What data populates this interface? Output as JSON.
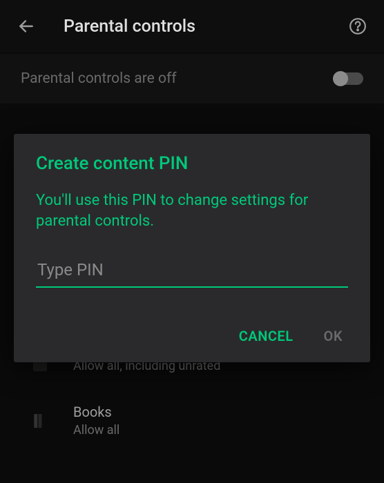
{
  "topbar": {
    "title": "Parental controls"
  },
  "status": {
    "label": "Parental controls are off"
  },
  "dialog": {
    "title": "Create content PIN",
    "description": "You'll use this PIN to change settings for parental controls.",
    "pin_placeholder": "Type PIN",
    "cancel_label": "CANCEL",
    "ok_label": "OK"
  },
  "items": [
    {
      "title": "",
      "subtitle": "Allow all, including unrated"
    },
    {
      "title": "Books",
      "subtitle": "Allow all"
    }
  ]
}
